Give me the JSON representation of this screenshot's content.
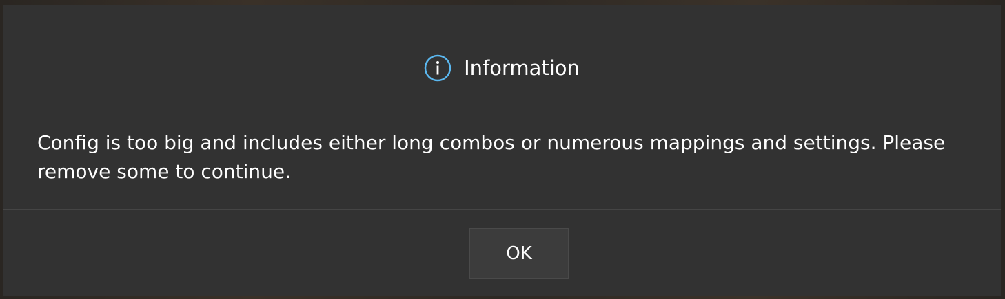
{
  "dialog": {
    "title": "Information",
    "icon": "info-circle-icon",
    "message": "Config is too big and includes either long combos or numerous mappings and settings. Please remove some to continue.",
    "ok_label": "OK"
  },
  "colors": {
    "dialog_background": "#323232",
    "icon_accent": "#5bb8f0",
    "text": "#ffffff",
    "button_background": "#3c3c3c"
  }
}
